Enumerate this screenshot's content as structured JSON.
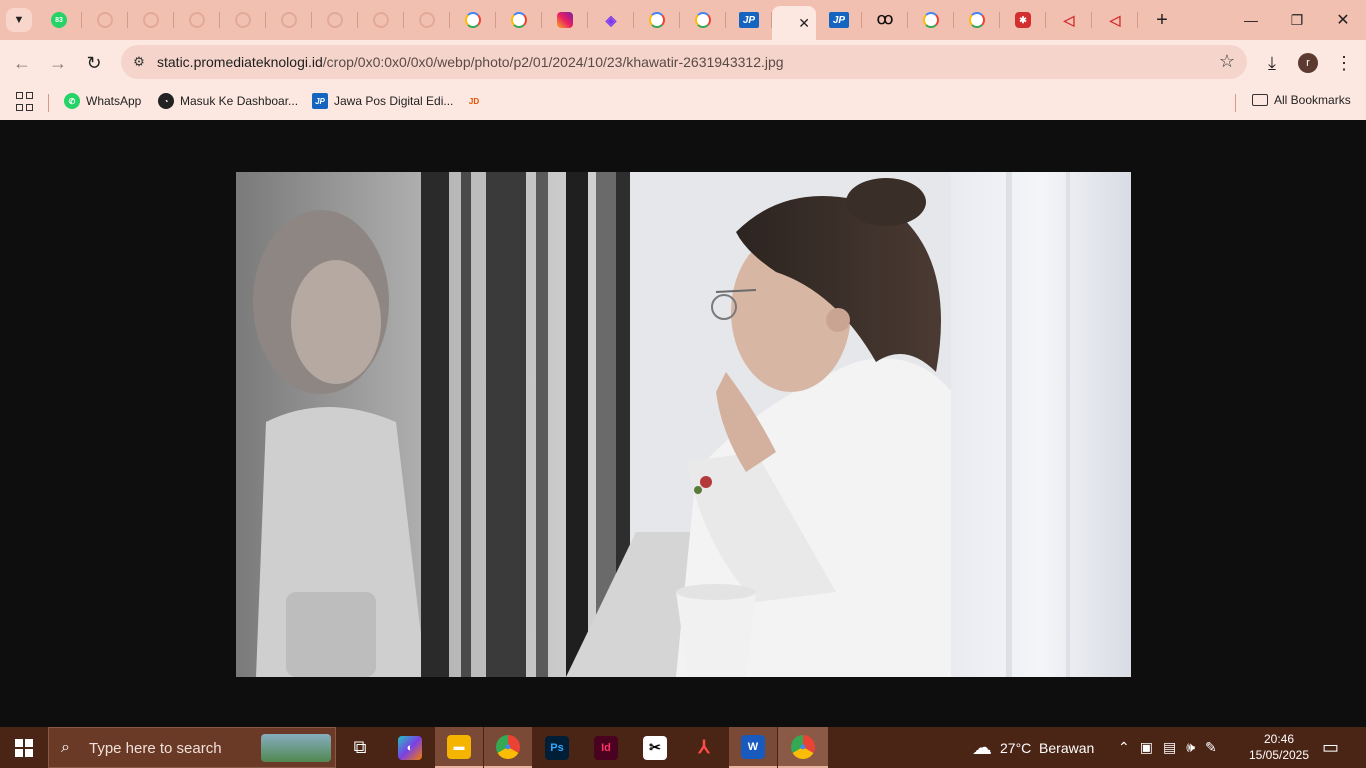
{
  "browser": {
    "tabs": [
      {
        "icon": "whatsapp-icon",
        "text": "83"
      },
      {
        "icon": "ghost-icon",
        "text": ""
      },
      {
        "icon": "ghost-icon",
        "text": ""
      },
      {
        "icon": "ghost-icon",
        "text": ""
      },
      {
        "icon": "ghost-icon",
        "text": ""
      },
      {
        "icon": "ghost-icon",
        "text": ""
      },
      {
        "icon": "ghost-icon",
        "text": ""
      },
      {
        "icon": "ghost-icon",
        "text": ""
      },
      {
        "icon": "ghost-icon",
        "text": ""
      },
      {
        "icon": "google-icon",
        "text": ""
      },
      {
        "icon": "google-icon",
        "text": ""
      },
      {
        "icon": "instagram-icon",
        "text": ""
      },
      {
        "icon": "diamond-icon",
        "text": ""
      },
      {
        "icon": "google-icon",
        "text": ""
      },
      {
        "icon": "google-icon",
        "text": ""
      },
      {
        "icon": "jawapos-icon",
        "text": "JP"
      }
    ],
    "active_tab": {
      "close": "✕"
    },
    "tabs_after": [
      {
        "icon": "jawapos-icon",
        "text": "JP"
      },
      {
        "icon": "oo-icon",
        "text": "Ꝏ"
      },
      {
        "icon": "google-icon",
        "text": ""
      },
      {
        "icon": "google-icon",
        "text": ""
      },
      {
        "icon": "red-app-icon",
        "text": "✱"
      },
      {
        "icon": "triangle-icon",
        "text": "◁"
      },
      {
        "icon": "triangle-icon",
        "text": "◁"
      }
    ],
    "new_tab": "+",
    "window": {
      "minimize": "—",
      "restore": "❐",
      "close": "✕"
    },
    "url_host": "static.promediateknologi.id",
    "url_path": "/crop/0x0:0x0/0x0/webp/photo/p2/01/2024/10/23/khawatir-2631943312.jpg",
    "profile_initial": "r",
    "bookmarks": [
      {
        "label": "WhatsApp",
        "icon": "whatsapp-icon"
      },
      {
        "label": "Masuk Ke Dashboar...",
        "icon": "dashboard-icon"
      },
      {
        "label": "Jawa Pos Digital Edi...",
        "icon": "jawapos-icon"
      },
      {
        "label": "",
        "icon": "jdih-icon"
      }
    ],
    "all_bookmarks": "All Bookmarks"
  },
  "taskbar": {
    "search_placeholder": "Type here to search",
    "apps": [
      {
        "name": "task-view",
        "label": "⧉"
      },
      {
        "name": "copilot",
        "label": "◐"
      },
      {
        "name": "file-explorer",
        "label": "▬"
      },
      {
        "name": "chrome",
        "label": "●"
      },
      {
        "name": "photoshop",
        "label": "Ps"
      },
      {
        "name": "indesign",
        "label": "Id"
      },
      {
        "name": "capcut",
        "label": "✂"
      },
      {
        "name": "acrobat",
        "label": "⅄"
      },
      {
        "name": "word",
        "label": "W"
      },
      {
        "name": "chrome-profile",
        "label": "●"
      }
    ],
    "weather": "27°C  Berawan",
    "time": "20:46",
    "date": "15/05/2025"
  },
  "colors": {
    "tab_strip": "#f2c0b0",
    "toolbar": "#fde8e1",
    "content_bg": "#0e0e0e",
    "taskbar": "#4a2414"
  }
}
